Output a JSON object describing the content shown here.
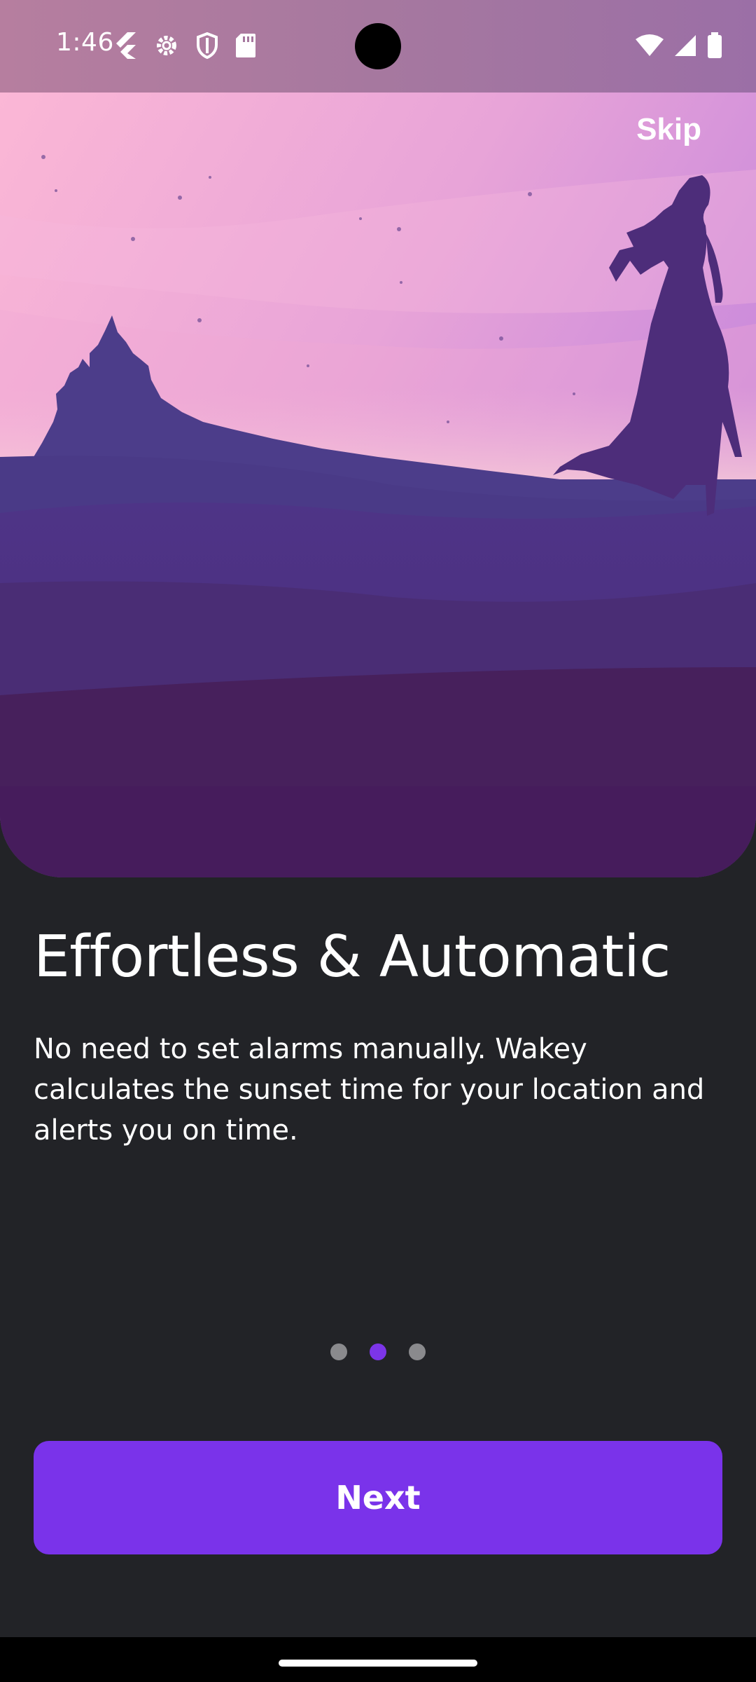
{
  "status_bar": {
    "time": "1:46",
    "left_icons": [
      "flutter-icon",
      "settings-gear-icon",
      "shield-icon",
      "sd-card-icon"
    ],
    "right_icons": [
      "wifi-icon",
      "signal-icon",
      "battery-icon"
    ]
  },
  "onboarding": {
    "skip_label": "Skip",
    "title": "Effortless & Automatic",
    "description": "No need to set alarms manually. Wakey calculates the sunset time for your location and alerts you on time.",
    "page_indicator": {
      "total": 3,
      "current": 2
    },
    "next_label": "Next"
  },
  "colors": {
    "background": "#222327",
    "accent": "#7a33ea",
    "dot_inactive": "#8a8a8d"
  }
}
